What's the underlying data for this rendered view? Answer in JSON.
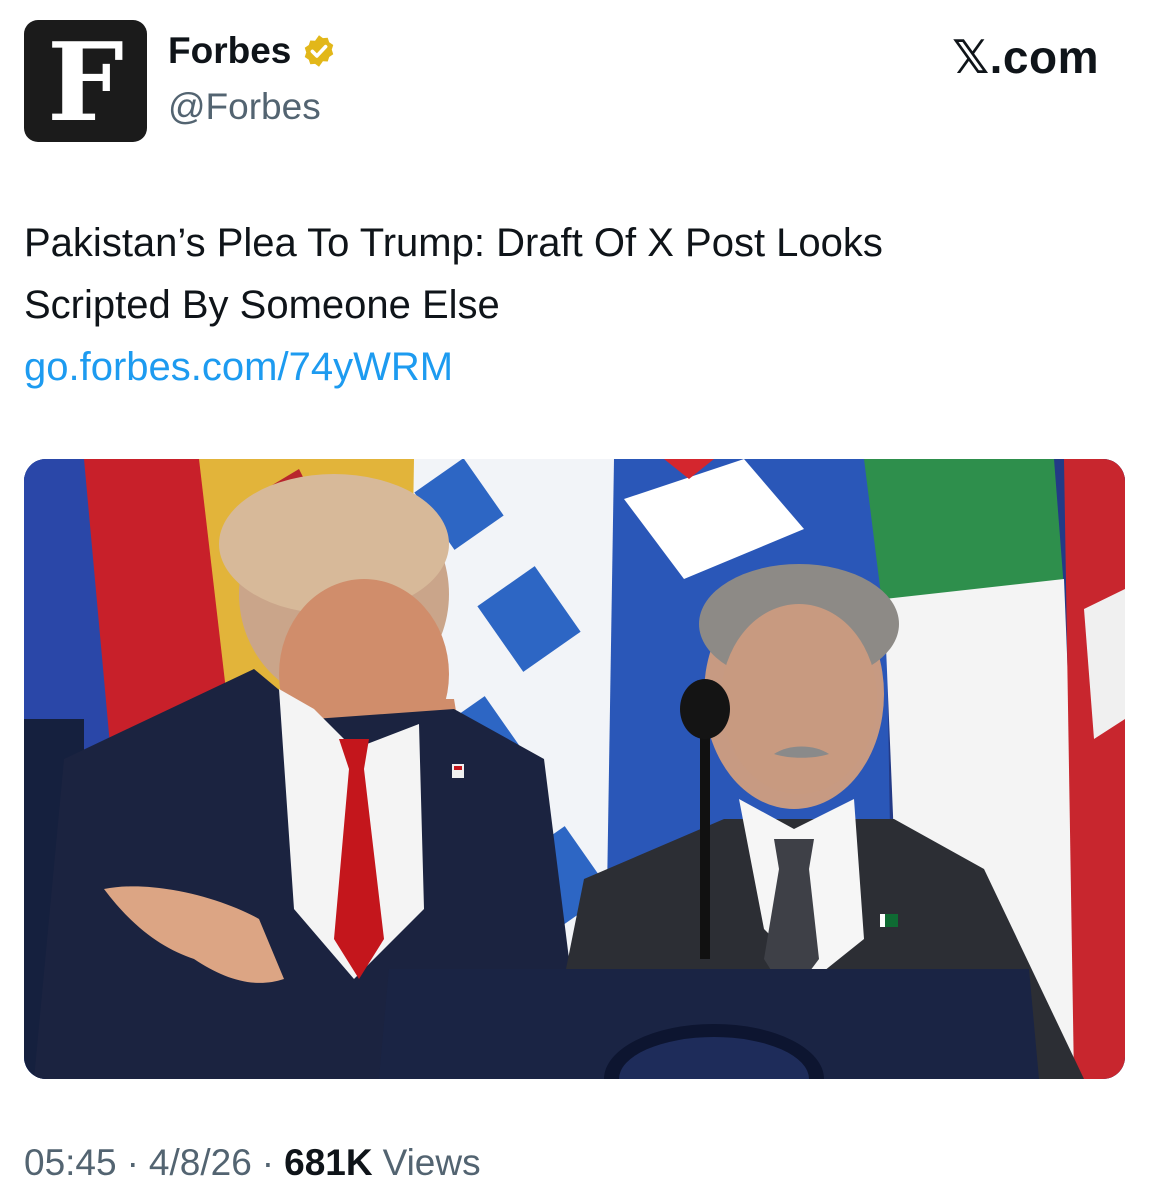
{
  "account": {
    "avatar_letter": "F",
    "display_name": "Forbes",
    "handle": "@Forbes",
    "verified_icon": "gold-verified-badge-icon",
    "verified_color": "#e2b719"
  },
  "brand": {
    "label": "𝕏.com"
  },
  "tweet": {
    "text_line1": "Pakistan’s Plea To Trump: Draft Of X Post Looks",
    "text_line2": "Scripted By Someone Else",
    "link": "go.forbes.com/74yWRM",
    "link_color": "#1d9bf0"
  },
  "meta": {
    "time": "05:45",
    "date": "4/8/26",
    "views_count": "681K",
    "views_label": "Views",
    "separator": "·"
  }
}
